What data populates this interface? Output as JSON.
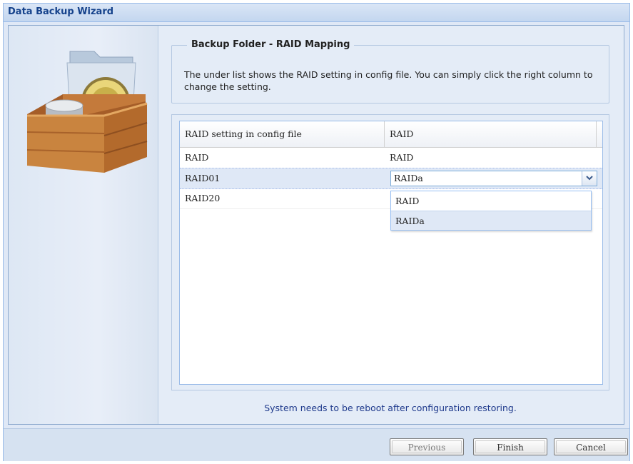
{
  "window": {
    "title": "Data Backup Wizard"
  },
  "left_panel": {
    "icon": "backup-box-icon"
  },
  "section": {
    "legend": "Backup Folder - RAID Mapping",
    "description": "The under list shows the RAID setting in config file. You can simply click the right column to change the setting."
  },
  "grid": {
    "columns": [
      "RAID setting in config file",
      "RAID"
    ],
    "rows": [
      {
        "config": "RAID",
        "raid": "RAID"
      },
      {
        "config": "RAID01",
        "raid": "RAIDa"
      },
      {
        "config": "RAID20",
        "raid": ""
      }
    ],
    "editor": {
      "value": "RAIDa",
      "trigger_icon": "chevron-down-icon"
    },
    "dropdown_options": [
      "RAID",
      "RAIDa"
    ]
  },
  "notice": "System needs to be reboot after configuration restoring.",
  "buttons": {
    "previous": "Previous",
    "finish": "Finish",
    "cancel": "Cancel"
  }
}
